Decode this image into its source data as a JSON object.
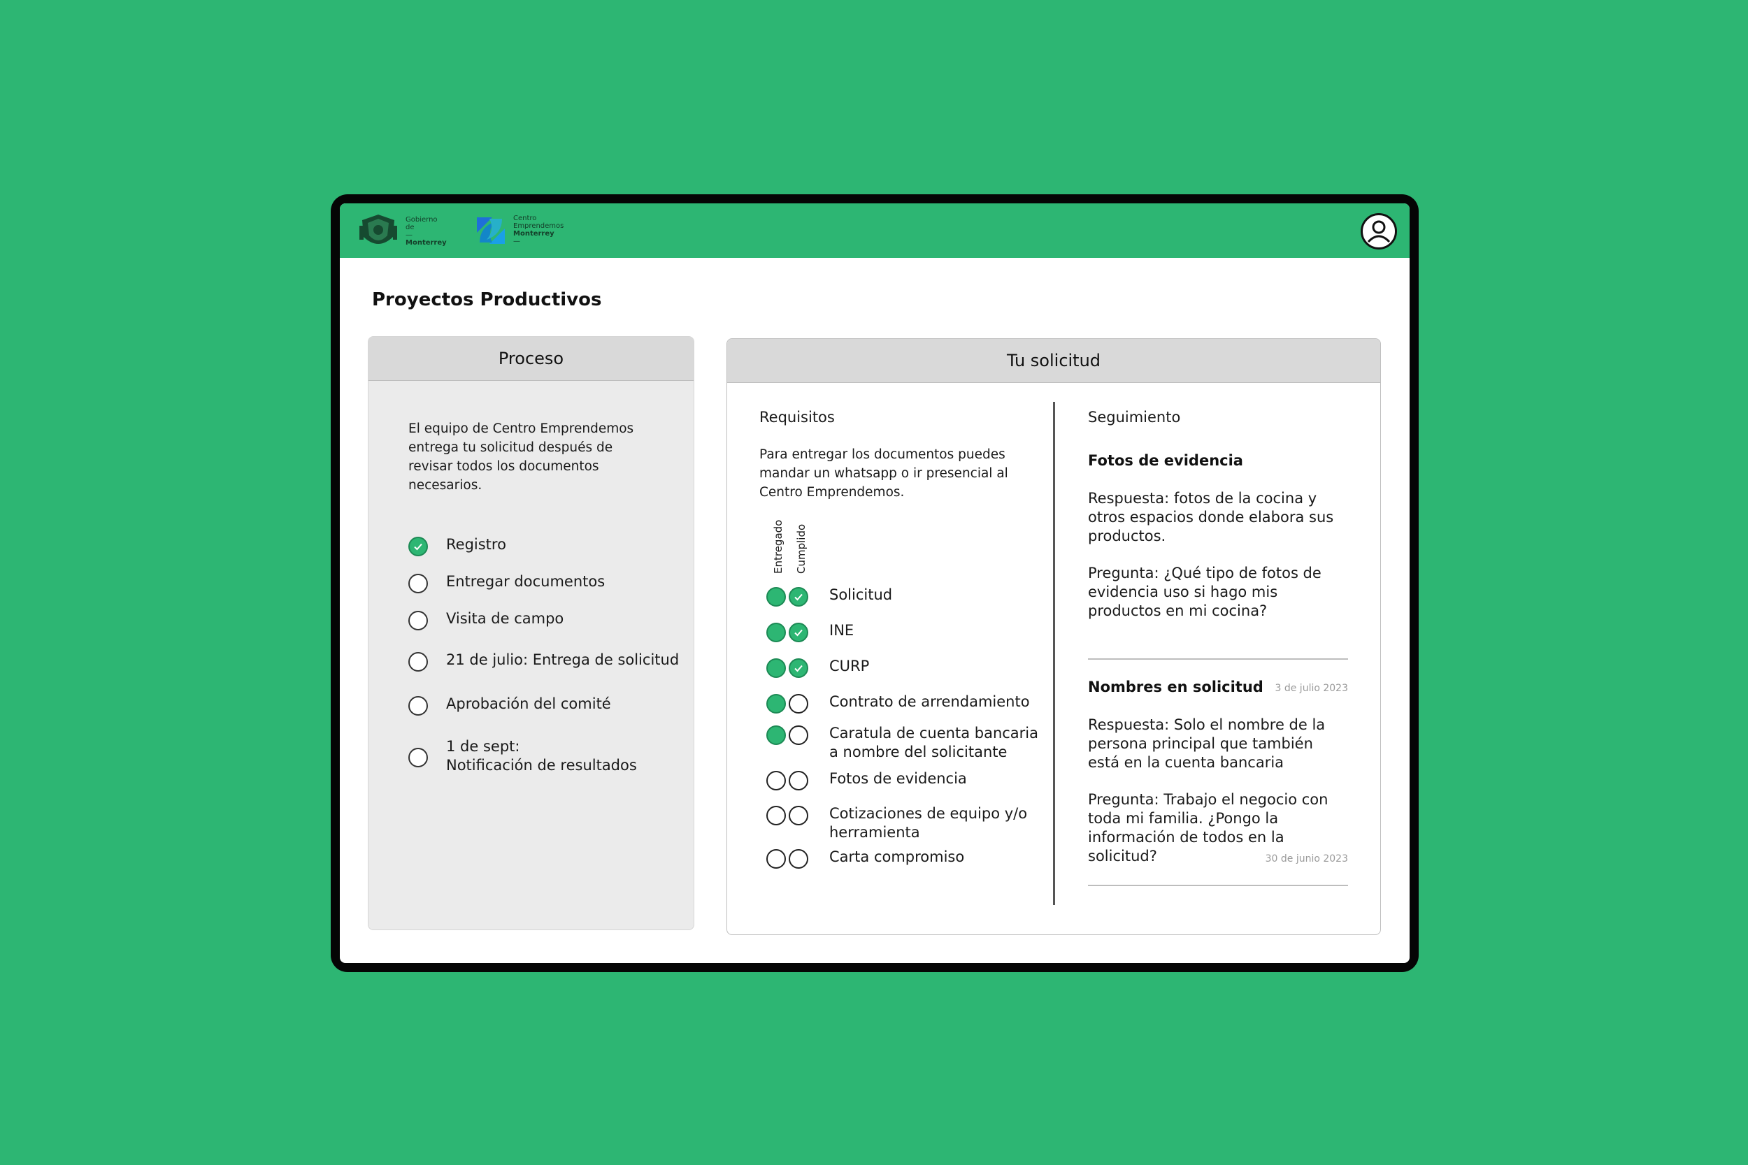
{
  "header": {
    "gobierno_lines": [
      "Gobierno",
      "de",
      "Monterrey"
    ],
    "emprendemos_lines": [
      "Centro",
      "Emprendemos",
      "Monterrey"
    ]
  },
  "page_title": "Proyectos Productivos",
  "proceso": {
    "title": "Proceso",
    "description": "El equipo de Centro Emprendemos entrega tu solicitud después de revisar todos los documentos necesarios.",
    "steps": [
      {
        "label": "Registro",
        "done": true
      },
      {
        "label": "Entregar documentos",
        "done": false
      },
      {
        "label": "Visita de campo",
        "done": false
      },
      {
        "label": "21 de julio: Entrega de solicitud",
        "done": false
      },
      {
        "label": "Aprobación del comité",
        "done": false
      },
      {
        "label": "1 de sept:\nNotificación de resultados",
        "done": false
      }
    ]
  },
  "solicitud": {
    "title": "Tu solicitud",
    "requisitos": {
      "title": "Requisitos",
      "description": "Para entregar los documentos puedes mandar un whatsapp o ir presencial al Centro Emprendemos.",
      "col_entregado": "Entregado",
      "col_cumplido": "Cumplido",
      "items": [
        {
          "label": "Solicitud",
          "entregado": true,
          "cumplido": true
        },
        {
          "label": "INE",
          "entregado": true,
          "cumplido": true
        },
        {
          "label": "CURP",
          "entregado": true,
          "cumplido": true
        },
        {
          "label": "Contrato de arrendamiento",
          "entregado": true,
          "cumplido": false
        },
        {
          "label": "Caratula de cuenta bancaria a nombre del solicitante",
          "entregado": true,
          "cumplido": false
        },
        {
          "label": "Fotos de evidencia",
          "entregado": false,
          "cumplido": false
        },
        {
          "label": "Cotizaciones de equipo y/o herramienta",
          "entregado": false,
          "cumplido": false
        },
        {
          "label": "Carta compromiso",
          "entregado": false,
          "cumplido": false
        }
      ]
    },
    "seguimiento": {
      "title": "Seguimiento",
      "entries": [
        {
          "heading": "Fotos de evidencia",
          "respuesta": "Respuesta: fotos de la cocina y otros espacios donde elabora sus productos.",
          "pregunta": "Pregunta: ¿Qué tipo de fotos de evidencia uso si hago mis productos en mi cocina?",
          "date": "3 de julio 2023"
        },
        {
          "heading": "Nombres en solicitud",
          "respuesta": "Respuesta: Solo el nombre de la persona principal que también está en la cuenta bancaria",
          "pregunta": "Pregunta: Trabajo el negocio con toda mi familia. ¿Pongo la información de todos en la solicitud?",
          "date": "30 de junio 2023"
        }
      ]
    }
  }
}
